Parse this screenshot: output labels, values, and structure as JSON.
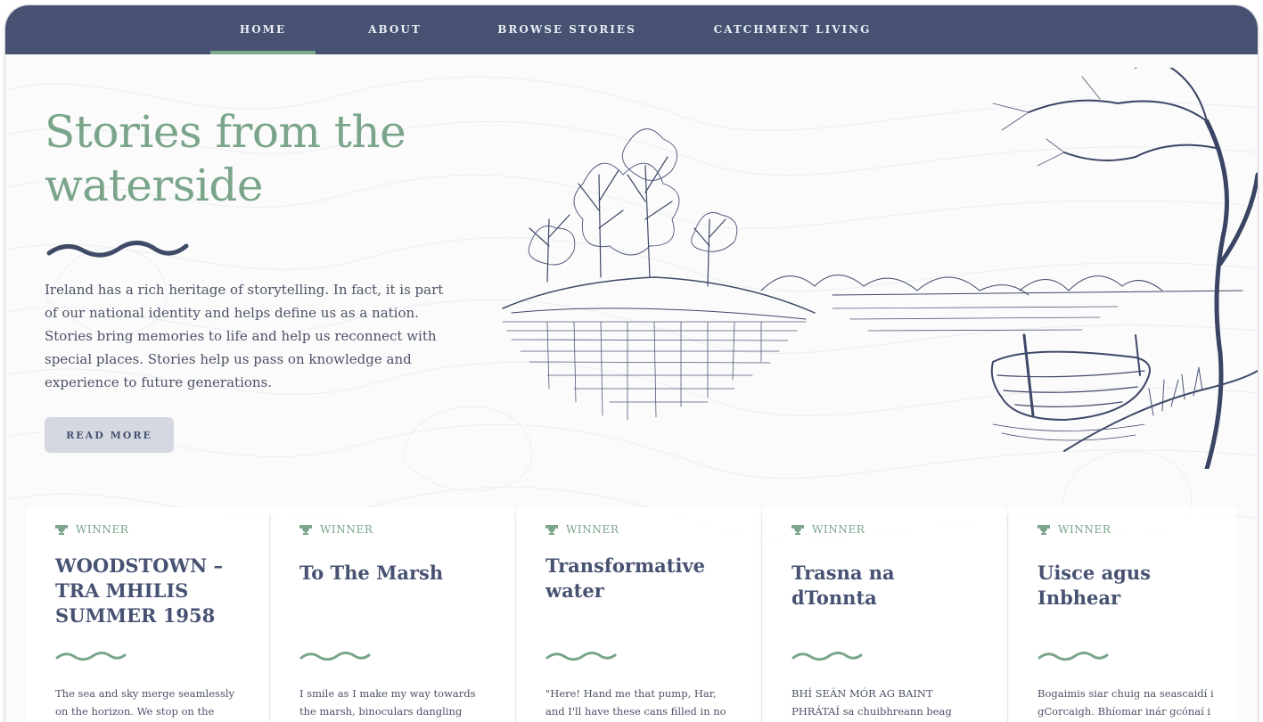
{
  "nav": {
    "items": [
      {
        "label": "HOME",
        "active": true
      },
      {
        "label": "ABOUT",
        "active": false
      },
      {
        "label": "BROWSE STORIES",
        "active": false
      },
      {
        "label": "CATCHMENT LIVING",
        "active": false
      }
    ]
  },
  "hero": {
    "title_line1": "Stories from the",
    "title_line2": "waterside",
    "body_lines": [
      "Ireland has a rich heritage of storytelling. In fact, it is part",
      "of our national identity and helps define us as a nation.",
      "Stories bring memories to life and help us reconnect with",
      "special places. Stories help us pass on knowledge and",
      "experience to future generations."
    ],
    "read_more_label": "READ MORE"
  },
  "cards": [
    {
      "badge": "WINNER",
      "title_lines": [
        "WOODSTOWN –",
        "TRA MHILIS",
        "SUMMER 1958"
      ],
      "excerpt_lines": [
        "The sea and sky merge seamlessly",
        "on the horizon. We stop on the"
      ]
    },
    {
      "badge": "WINNER",
      "title_lines": [
        "To The Marsh"
      ],
      "excerpt_lines": [
        "I smile as I make my way towards",
        "the marsh, binoculars dangling"
      ]
    },
    {
      "badge": "WINNER",
      "title_lines": [
        "Transformative",
        "water"
      ],
      "excerpt_lines": [
        "\"Here! Hand me that pump, Har,",
        "and I'll have these cans filled in no"
      ]
    },
    {
      "badge": "WINNER",
      "title_lines": [
        "Trasna na dTonnta"
      ],
      "excerpt_lines": [
        "BHÍ SEÁN MÓR AG BAINT",
        "PHRÁTAÍ sa chuibhreann beag"
      ]
    },
    {
      "badge": "WINNER",
      "title_lines": [
        "Uisce agus Inbhear"
      ],
      "excerpt_lines": [
        "Bogaimis siar chuig na seascaidí i",
        "gCorcaigh. Bhíomar inár gcónaí i"
      ]
    }
  ],
  "icons": {
    "badge_icon": "trophy-icon",
    "divider": "wave-icon"
  },
  "colors": {
    "nav_bg": "#475272",
    "accent_green": "#7aa58a",
    "navy": "#475272",
    "button_bg": "#d5d8e1"
  }
}
